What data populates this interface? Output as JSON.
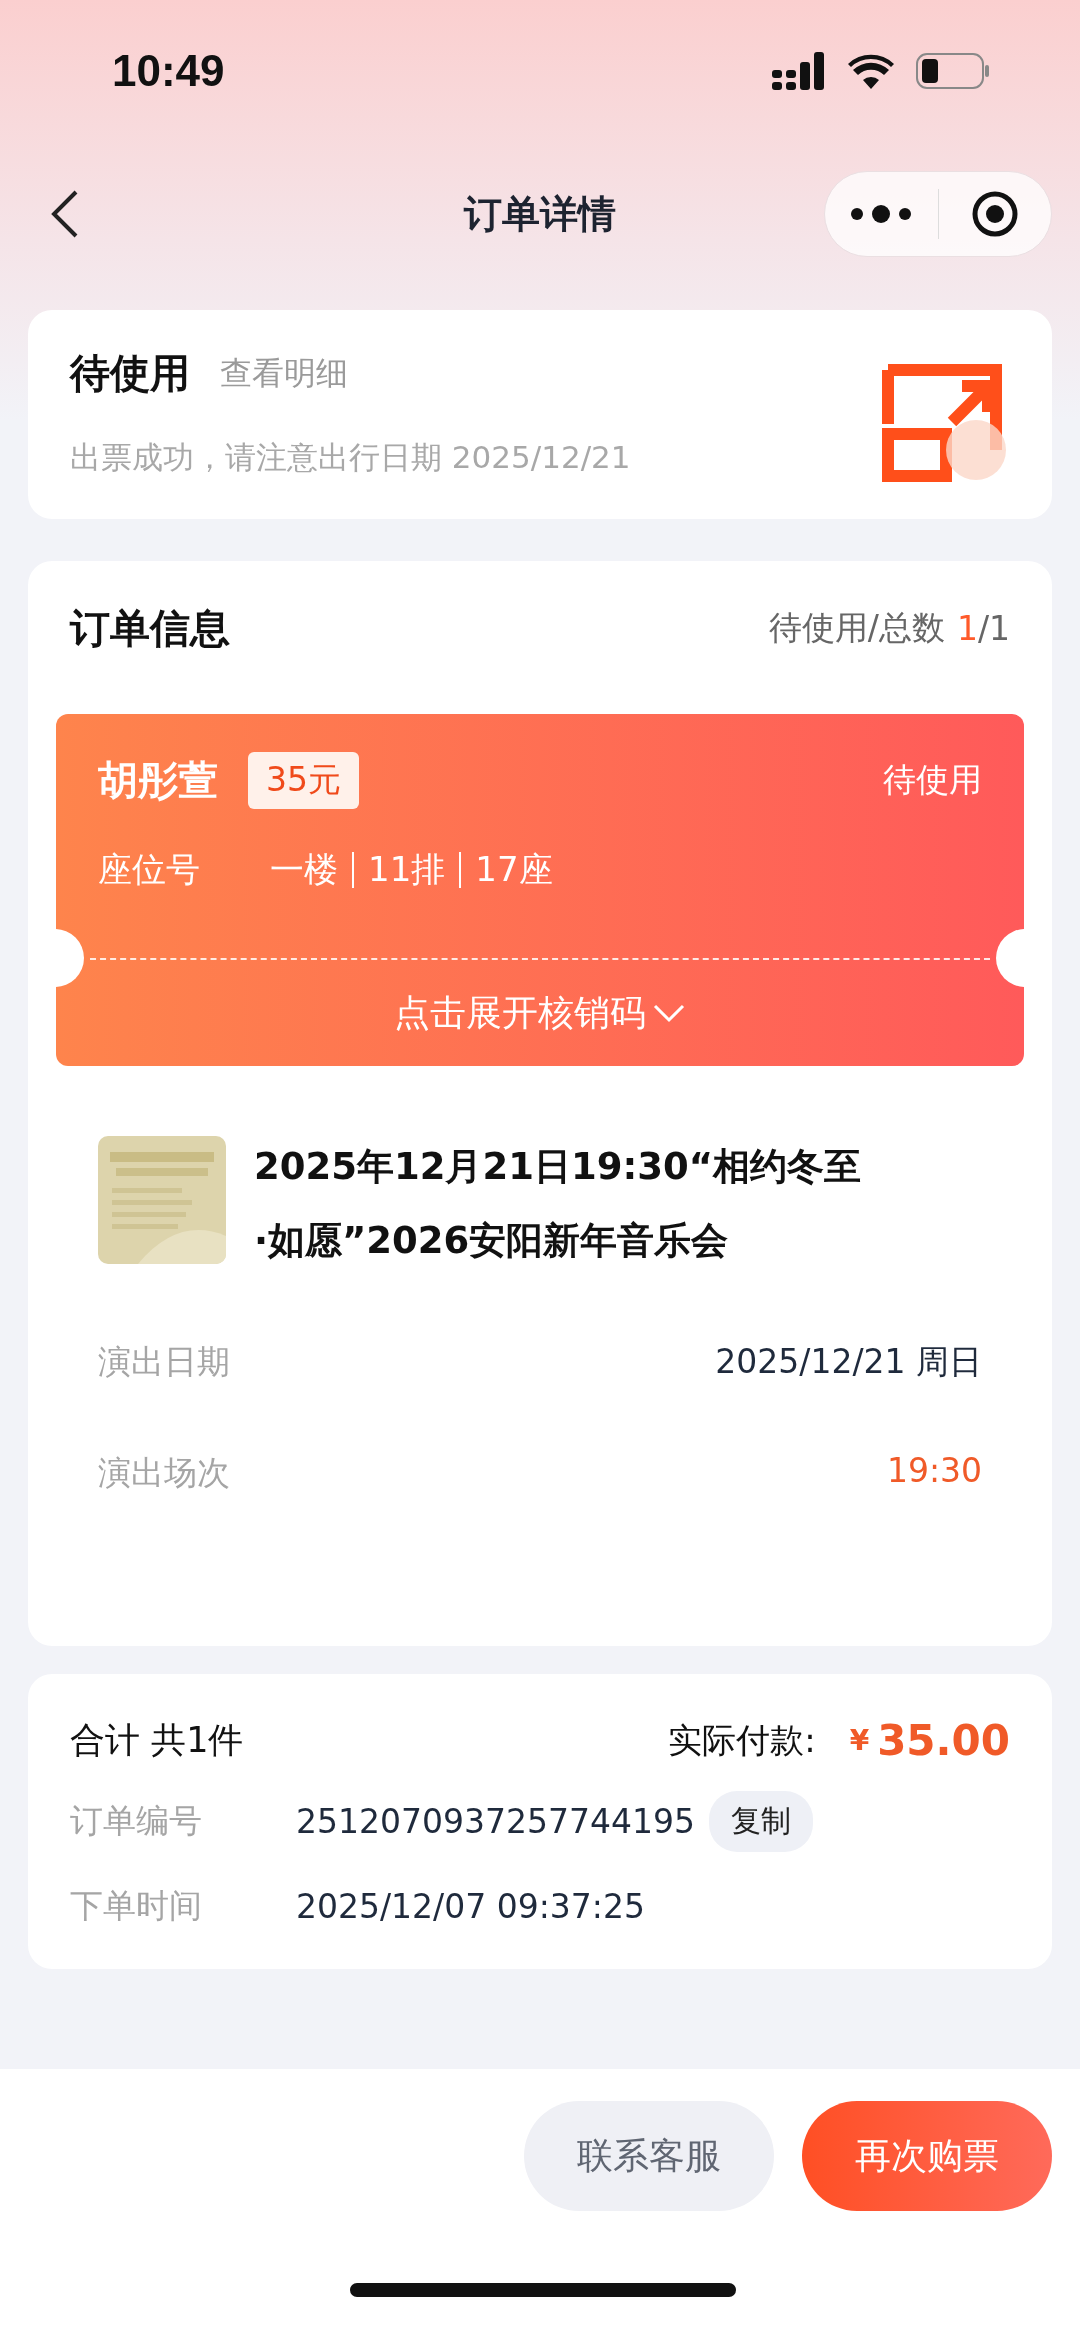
{
  "status_bar": {
    "time": "10:49"
  },
  "nav": {
    "title": "订单详情"
  },
  "status_card": {
    "status": "待使用",
    "detail_link": "查看明细",
    "message": "出票成功，请注意出行日期 2025/12/21"
  },
  "order_info": {
    "title": "订单信息",
    "count_label": "待使用/总数",
    "count_done": "1",
    "count_total": "/1",
    "ticket": {
      "holder": "胡彤萱",
      "price": "35元",
      "status": "待使用",
      "seat_label": "座位号",
      "seat_parts": [
        "一楼",
        "11排",
        "17座"
      ],
      "expand_label": "点击展开核销码",
      "expanded": false
    },
    "event": {
      "title": "2025年12月21日19:30“相约冬至·如愿”2026安阳新年音乐会"
    },
    "rows": [
      {
        "label": "演出日期",
        "value": "2025/12/21 周日",
        "highlight": false
      },
      {
        "label": "演出场次",
        "value": "19:30",
        "highlight": true
      }
    ]
  },
  "summary": {
    "total_label": "合计 共1件",
    "paid_label": "实际付款:",
    "currency": "¥",
    "amount": "35.00",
    "rows": [
      {
        "label": "订单编号",
        "value": "2512070937257744195",
        "action": "复制"
      },
      {
        "label": "下单时间",
        "value": "2025/12/07 09:37:25"
      }
    ]
  },
  "actions": [
    {
      "label": "联系客服",
      "primary": false
    },
    {
      "label": "再次购票",
      "primary": true
    }
  ]
}
